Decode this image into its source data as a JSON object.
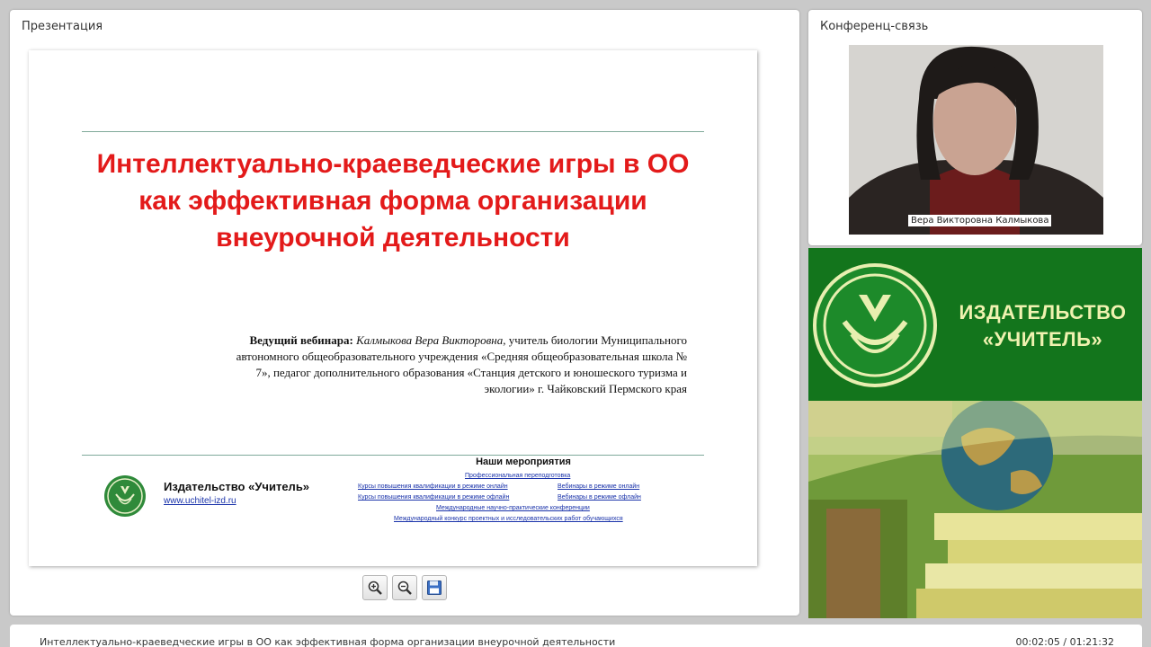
{
  "presentation": {
    "panel_title": "Презентация",
    "slide": {
      "title": "Интеллектуально-краеведческие игры в ОО как эффективная форма организации внеурочной деятельности",
      "presenter_label": "Ведущий вебинара:",
      "presenter_name": "Калмыкова Вера Викторовна",
      "presenter_desc": ", учитель биологии Муниципального автономного общеобразовательного учреждения «Средняя общеобразовательная школа № 7», педагог дополнительного образования «Станция детского и юношеского туризма и экологии» г. Чайковский Пермского края",
      "publisher_name": "Издательство «Учитель»",
      "publisher_url": "www.uchitel-izd.ru",
      "events_heading": "Наши мероприятия",
      "events": {
        "e1": "Профессиональная переподготовка",
        "e2": "Курсы повышения квалификации в режиме онлайн",
        "e3": "Вебинары в режиме онлайн",
        "e4": "Курсы повышения квалификации в режиме офлайн",
        "e5": "Вебинары в режиме офлайн",
        "e6": "Международные научно-практические конференции",
        "e7": "Международный конкурс проектных и исследовательских работ обучающихся"
      }
    },
    "tools": {
      "zoom_in_icon": "zoom-in-icon",
      "zoom_out_icon": "zoom-out-icon",
      "save_icon": "floppy-disk-icon"
    }
  },
  "conference": {
    "panel_title": "Конференц-связь",
    "participant_name": "Вера Викторовна Калмыкова"
  },
  "banner": {
    "publisher_line1": "ИЗДАТЕЛЬСТВО",
    "publisher_line2": "«УЧИТЕЛЬ»"
  },
  "status": {
    "title": "Интеллектуально-краеведческие игры в ОО как эффективная форма организации внеурочной деятельности",
    "time": "00:02:05 / 01:21:32"
  },
  "colors": {
    "title_red": "#e31a1a",
    "banner_green": "#13751c",
    "link_blue": "#1a33aa"
  }
}
